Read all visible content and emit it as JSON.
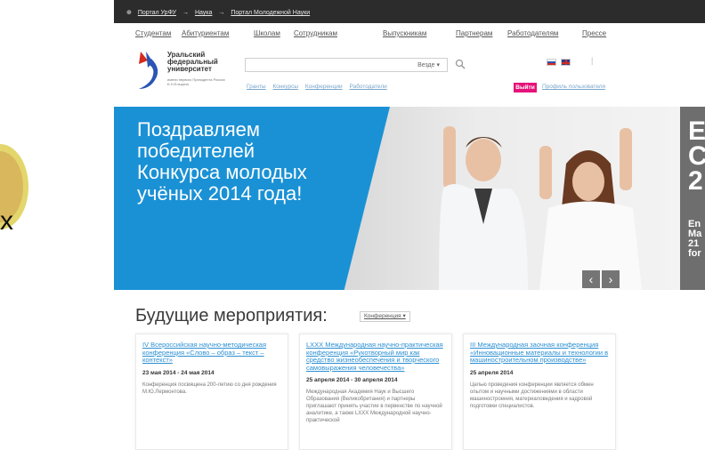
{
  "breadcrumbs": [
    "Портал УрФУ",
    "→",
    "Наука",
    "→",
    "Портал Молодежной Науки"
  ],
  "main_nav": [
    "Студентам",
    "Абитуриентам",
    "Школам",
    "Сотрудникам",
    "Выпускникам",
    "Партнерам",
    "Работодателям",
    "Прессе"
  ],
  "logo": {
    "line1": "Уральский",
    "line2": "федеральный",
    "line3": "университет",
    "subtitle": "имени первого Президента России Б.Н.Ельцина"
  },
  "search": {
    "value": "",
    "scope": "Везде ▾"
  },
  "sub_nav": [
    "Гранты",
    "Конкурсы",
    "Конференции",
    "Работодатели"
  ],
  "header_actions": {
    "login_label": "Выйти",
    "profile_label": "Профиль пользователя"
  },
  "hero": {
    "title": "Поздравляем победителей Конкурса молодых учёных 2014 года!",
    "right_big": "E\nC\n2",
    "right_small": "En\nMa\n21\nfor",
    "prev": "‹",
    "next": "›"
  },
  "left_edge_text": "х",
  "events": {
    "heading": "Будущие мероприятия:",
    "filter": "Конференция ▾",
    "cards": [
      {
        "title": "IV Всероссийская научно-методическая конференция «Слово – образ – текст – контекст»",
        "date": "23 мая 2014 - 24 мая 2014",
        "desc": "Конференция посвящена 200-летию со дня рождения М.Ю.Лермонтова."
      },
      {
        "title": "LXXX Международная научно-практическая конференция «Рукотворный мир как средство жизнеобеспечения и творческого самовыражения человечества»",
        "date": "25 апреля 2014 - 30 апреля 2014",
        "desc": "Международная Академия Наук и Высшего Образования (Великобритания) и партнеры приглашают принять участие в первенстве по научной аналитике, а также LXXX Международной научно-практической"
      },
      {
        "title": "III Международная заочная конференция «Инновационные материалы и технологии в машиностроительном производстве»",
        "date": "25 апреля 2014",
        "desc": "Целью проведения конференции является обмен опытом и научными достижениями в области машиностроения, материаловедения и кадровой подготовки специалистов."
      }
    ]
  },
  "colors": {
    "accent_blue": "#1a91d5",
    "login_pink": "#e6127a",
    "link_blue": "#2b8fd3",
    "topbar": "#2c2c2c"
  }
}
